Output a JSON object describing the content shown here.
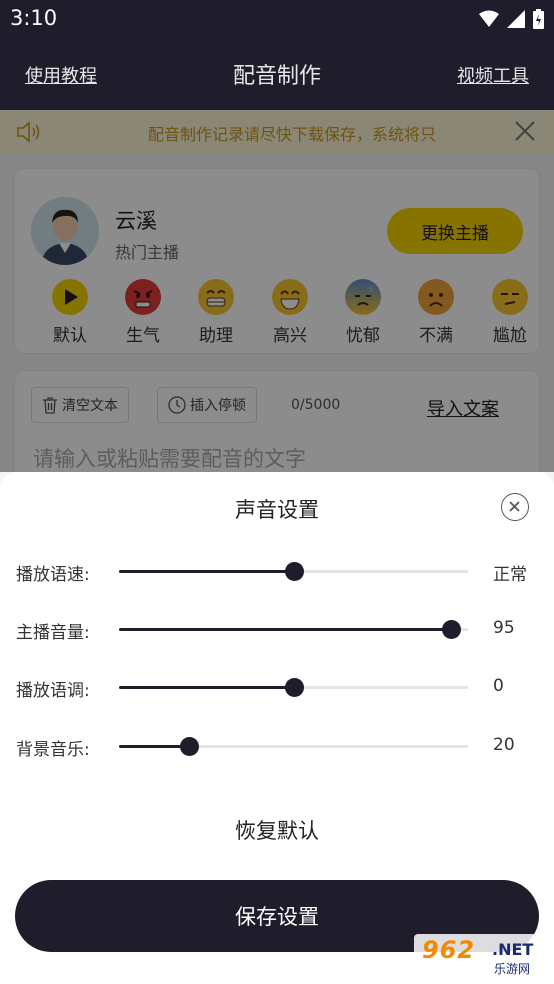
{
  "status": {
    "time": "3:10"
  },
  "header": {
    "left_link": "使用教程",
    "title": "配音制作",
    "right_link": "视频工具"
  },
  "notice": {
    "text": "配音制作记录请尽快下载保存，系统将只"
  },
  "anchor": {
    "name": "云溪",
    "subtitle": "热门主播",
    "change_button": "更换主播"
  },
  "emotions": [
    {
      "label": "默认",
      "icon": "play-icon"
    },
    {
      "label": "生气",
      "icon": "angry-face-icon"
    },
    {
      "label": "助理",
      "icon": "grin-face-icon"
    },
    {
      "label": "高兴",
      "icon": "happy-face-icon"
    },
    {
      "label": "忧郁",
      "icon": "sad-face-icon"
    },
    {
      "label": "不满",
      "icon": "frown-face-icon"
    },
    {
      "label": "尴尬",
      "icon": "awkward-face-icon"
    }
  ],
  "text_panel": {
    "clear_label": "清空文本",
    "pause_label": "插入停顿",
    "count": "0/5000",
    "import_label": "导入文案",
    "placeholder": "请输入或粘贴需要配音的文字"
  },
  "sheet": {
    "title": "声音设置",
    "sliders": [
      {
        "label": "播放语速:",
        "value_text": "正常",
        "fraction": 0.5
      },
      {
        "label": "主播音量:",
        "value_text": "95",
        "fraction": 0.95
      },
      {
        "label": "播放语调:",
        "value_text": "0",
        "fraction": 0.5
      },
      {
        "label": "背景音乐:",
        "value_text": "20",
        "fraction": 0.2
      }
    ],
    "reset_label": "恢复默认",
    "save_label": "保存设置"
  },
  "watermark": {
    "main": "962",
    "net": ".NET",
    "sub": "乐游网"
  },
  "colors": {
    "dark": "#1f1d2b",
    "accent": "#f5d200",
    "notice_text": "#c89a20"
  }
}
